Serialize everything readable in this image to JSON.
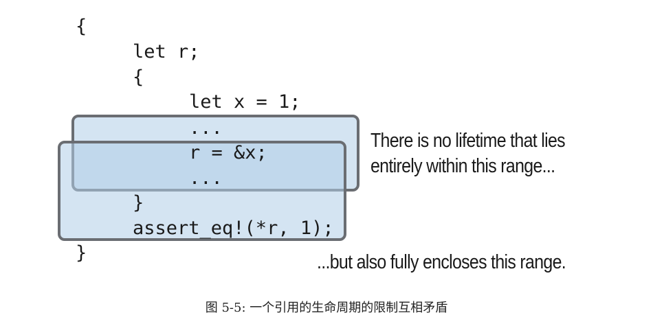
{
  "code": {
    "lines": [
      "{",
      "let r;",
      "{",
      "let x = 1;",
      "...",
      "r = &x;",
      "...",
      "}",
      "assert_eq!(*r, 1);",
      "}"
    ]
  },
  "annotations": {
    "upper": [
      "There is no lifetime that lies",
      "entirely within this range..."
    ],
    "lower": "...but also fully encloses this range."
  },
  "caption": "图 5-5: 一个引用的生命周期的限制互相矛盾"
}
